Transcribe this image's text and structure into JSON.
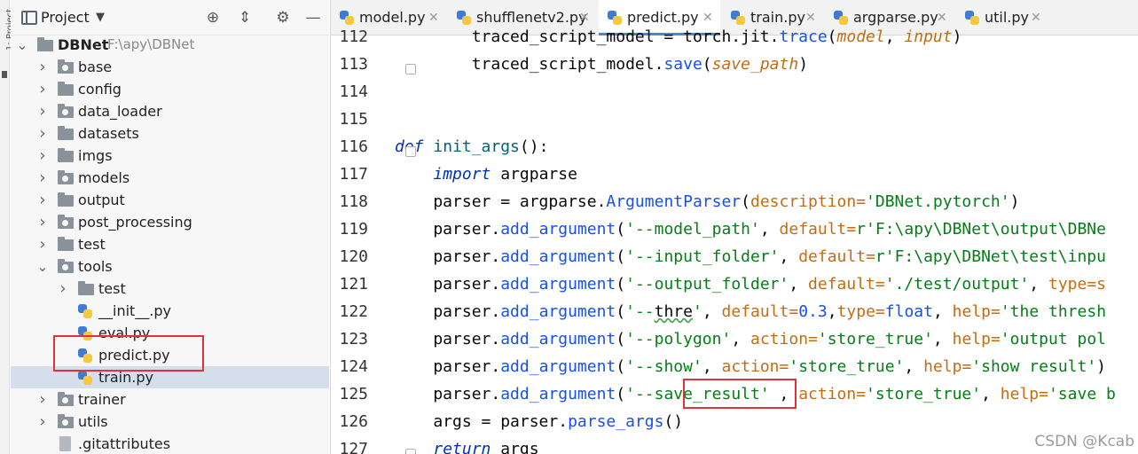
{
  "stripe": {
    "label": "1: Project"
  },
  "project_panel": {
    "title": "Project",
    "header_icons": [
      "panel-icon",
      "locate-icon",
      "collapse-icon",
      "settings-icon",
      "minimize-icon"
    ],
    "tree": [
      {
        "name": "DBNet",
        "suffix": "F:\\apy\\DBNet",
        "type": "folder",
        "expanded": true
      },
      {
        "name": "base",
        "type": "package",
        "expanded": false
      },
      {
        "name": "config",
        "type": "folder",
        "expanded": false
      },
      {
        "name": "data_loader",
        "type": "package",
        "expanded": false
      },
      {
        "name": "datasets",
        "type": "folder",
        "expanded": false
      },
      {
        "name": "imgs",
        "type": "folder",
        "expanded": false
      },
      {
        "name": "models",
        "type": "package",
        "expanded": false
      },
      {
        "name": "output",
        "type": "folder",
        "expanded": false
      },
      {
        "name": "post_processing",
        "type": "package",
        "expanded": false
      },
      {
        "name": "test",
        "type": "folder",
        "expanded": false
      },
      {
        "name": "tools",
        "type": "package",
        "expanded": true
      },
      {
        "name": "test",
        "type": "folder",
        "expanded": false
      },
      {
        "name": "__init__.py",
        "type": "py"
      },
      {
        "name": "eval.py",
        "type": "py"
      },
      {
        "name": "predict.py",
        "type": "py"
      },
      {
        "name": "train.py",
        "type": "py",
        "selected": true
      },
      {
        "name": "trainer",
        "type": "package",
        "expanded": false
      },
      {
        "name": "utils",
        "type": "package",
        "expanded": false
      },
      {
        "name": ".gitattributes",
        "type": "file"
      }
    ]
  },
  "editor": {
    "tabs": [
      {
        "label": "model.py",
        "active": false
      },
      {
        "label": "shufflenetv2.py",
        "active": false
      },
      {
        "label": "predict.py",
        "active": true
      },
      {
        "label": "train.py",
        "active": false
      },
      {
        "label": "argparse.py",
        "active": false
      },
      {
        "label": "util.py",
        "active": false
      }
    ],
    "lines": [
      {
        "number": "112",
        "tokens": [
          {
            "t": "        traced_script_model = torch.jit.",
            "c": "default"
          },
          {
            "t": "trace",
            "c": "call"
          },
          {
            "t": "(",
            "c": "default"
          },
          {
            "t": "model",
            "c": "param"
          },
          {
            "t": ", ",
            "c": "default"
          },
          {
            "t": "input",
            "c": "param"
          },
          {
            "t": ")",
            "c": "default"
          }
        ]
      },
      {
        "number": "113",
        "tokens": [
          {
            "t": "        traced_script_model.",
            "c": "default"
          },
          {
            "t": "save",
            "c": "call"
          },
          {
            "t": "(",
            "c": "default"
          },
          {
            "t": "save_path",
            "c": "param"
          },
          {
            "t": ")",
            "c": "default"
          }
        ]
      },
      {
        "number": "114",
        "tokens": []
      },
      {
        "number": "115",
        "tokens": []
      },
      {
        "number": "116",
        "tokens": [
          {
            "t": "def ",
            "c": "kw"
          },
          {
            "t": "init_args",
            "c": "fn"
          },
          {
            "t": "():",
            "c": "default"
          }
        ]
      },
      {
        "number": "117",
        "tokens": [
          {
            "t": "    ",
            "c": "default"
          },
          {
            "t": "import",
            "c": "kw"
          },
          {
            "t": " argparse",
            "c": "default"
          }
        ]
      },
      {
        "number": "118",
        "tokens": [
          {
            "t": "    parser = argparse.",
            "c": "default"
          },
          {
            "t": "ArgumentParser",
            "c": "call"
          },
          {
            "t": "(",
            "c": "default"
          },
          {
            "t": "description=",
            "c": "kwarg"
          },
          {
            "t": "'DBNet.pytorch'",
            "c": "str"
          },
          {
            "t": ")",
            "c": "default"
          }
        ]
      },
      {
        "number": "119",
        "tokens": [
          {
            "t": "    parser.",
            "c": "default"
          },
          {
            "t": "add_argument",
            "c": "call"
          },
          {
            "t": "(",
            "c": "default"
          },
          {
            "t": "'--model_path'",
            "c": "str"
          },
          {
            "t": ", ",
            "c": "default"
          },
          {
            "t": "default=",
            "c": "kwarg"
          },
          {
            "t": "r'F:\\apy\\DBNet\\output\\DBNe",
            "c": "str"
          }
        ]
      },
      {
        "number": "120",
        "tokens": [
          {
            "t": "    parser.",
            "c": "default"
          },
          {
            "t": "add_argument",
            "c": "call"
          },
          {
            "t": "(",
            "c": "default"
          },
          {
            "t": "'--input_folder'",
            "c": "str"
          },
          {
            "t": ", ",
            "c": "default"
          },
          {
            "t": "default=",
            "c": "kwarg"
          },
          {
            "t": "r'F:\\apy\\DBNet\\test\\inpu",
            "c": "str"
          }
        ]
      },
      {
        "number": "121",
        "tokens": [
          {
            "t": "    parser.",
            "c": "default"
          },
          {
            "t": "add_argument",
            "c": "call"
          },
          {
            "t": "(",
            "c": "default"
          },
          {
            "t": "'--output_folder'",
            "c": "str"
          },
          {
            "t": ", ",
            "c": "default"
          },
          {
            "t": "default=",
            "c": "kwarg"
          },
          {
            "t": "'./test/output'",
            "c": "str"
          },
          {
            "t": ", ",
            "c": "default"
          },
          {
            "t": "type=s",
            "c": "kwarg"
          }
        ]
      },
      {
        "number": "122",
        "tokens": [
          {
            "t": "    parser.",
            "c": "default"
          },
          {
            "t": "add_argument",
            "c": "call"
          },
          {
            "t": "(",
            "c": "default"
          },
          {
            "t": "'--",
            "c": "str"
          },
          {
            "t": "thre",
            "c": "typo"
          },
          {
            "t": "'",
            "c": "str"
          },
          {
            "t": ", ",
            "c": "default"
          },
          {
            "t": "default=",
            "c": "kwarg"
          },
          {
            "t": "0.3",
            "c": "num"
          },
          {
            "t": ",",
            "c": "default"
          },
          {
            "t": "type=",
            "c": "kwarg"
          },
          {
            "t": "float",
            "c": "call"
          },
          {
            "t": ", ",
            "c": "default"
          },
          {
            "t": "help=",
            "c": "kwarg"
          },
          {
            "t": "'the thresh",
            "c": "str"
          }
        ]
      },
      {
        "number": "123",
        "tokens": [
          {
            "t": "    parser.",
            "c": "default"
          },
          {
            "t": "add_argument",
            "c": "call"
          },
          {
            "t": "(",
            "c": "default"
          },
          {
            "t": "'--polygon'",
            "c": "str"
          },
          {
            "t": ", ",
            "c": "default"
          },
          {
            "t": "action=",
            "c": "kwarg"
          },
          {
            "t": "'store_true'",
            "c": "str"
          },
          {
            "t": ", ",
            "c": "default"
          },
          {
            "t": "help=",
            "c": "kwarg"
          },
          {
            "t": "'output pol",
            "c": "str"
          }
        ]
      },
      {
        "number": "124",
        "tokens": [
          {
            "t": "    parser.",
            "c": "default"
          },
          {
            "t": "add_argument",
            "c": "call"
          },
          {
            "t": "(",
            "c": "default"
          },
          {
            "t": "'--show'",
            "c": "str"
          },
          {
            "t": ", ",
            "c": "default"
          },
          {
            "t": "action=",
            "c": "kwarg"
          },
          {
            "t": "'store_true'",
            "c": "str"
          },
          {
            "t": ", ",
            "c": "default"
          },
          {
            "t": "help=",
            "c": "kwarg"
          },
          {
            "t": "'show result'",
            "c": "str"
          },
          {
            "t": ")",
            "c": "default"
          }
        ]
      },
      {
        "number": "125",
        "tokens": [
          {
            "t": "    parser.",
            "c": "default"
          },
          {
            "t": "add_argument",
            "c": "call"
          },
          {
            "t": "(",
            "c": "default"
          },
          {
            "t": "'--save_result'",
            "c": "str"
          },
          {
            "t": " , ",
            "c": "default"
          },
          {
            "t": "action=",
            "c": "kwarg"
          },
          {
            "t": "'store_true'",
            "c": "str"
          },
          {
            "t": ", ",
            "c": "default"
          },
          {
            "t": "help=",
            "c": "kwarg"
          },
          {
            "t": "'save b",
            "c": "str"
          }
        ]
      },
      {
        "number": "126",
        "tokens": [
          {
            "t": "    args = parser.",
            "c": "default"
          },
          {
            "t": "parse_args",
            "c": "call"
          },
          {
            "t": "()",
            "c": "default"
          }
        ]
      },
      {
        "number": "127",
        "tokens": [
          {
            "t": "    ",
            "c": "default"
          },
          {
            "t": "return",
            "c": "kw"
          },
          {
            "t": " args",
            "c": "default"
          }
        ]
      }
    ]
  },
  "watermark": "CSDN @Kcab",
  "colors": {
    "selection": "#d5dfeb",
    "highlight_box": "#e0323a",
    "active_tab_underline": "#4a86c8",
    "keyword": "#0033b3",
    "string": "#067d17",
    "kwarg": "#c26d15"
  }
}
